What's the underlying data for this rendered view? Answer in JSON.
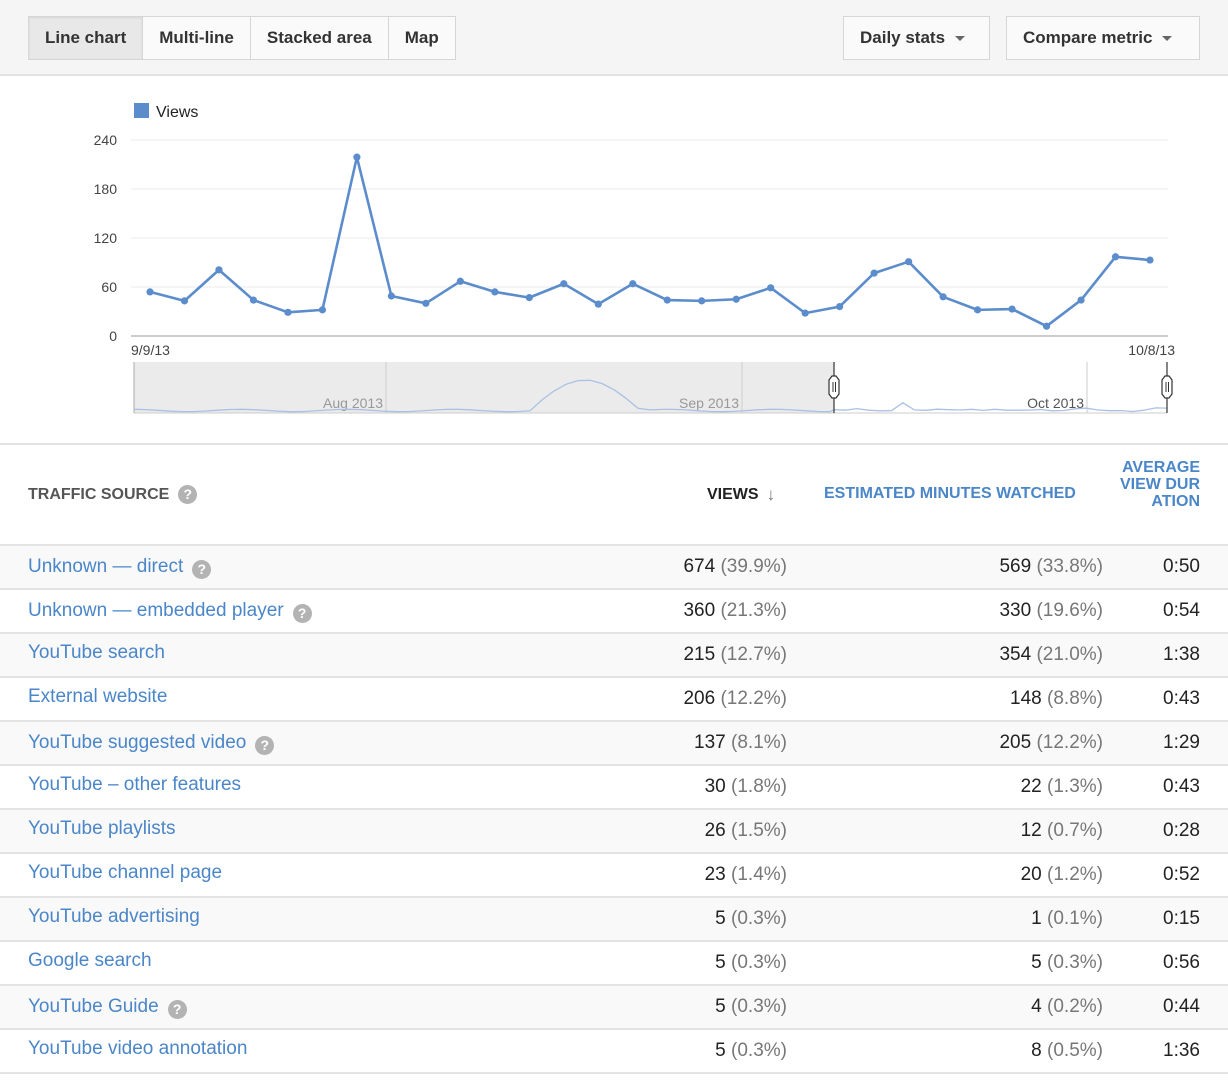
{
  "toolbar": {
    "chart_types": [
      {
        "label": "Line chart",
        "active": true
      },
      {
        "label": "Multi-line",
        "active": false
      },
      {
        "label": "Stacked area",
        "active": false
      },
      {
        "label": "Map",
        "active": false
      }
    ],
    "daily_stats_label": "Daily stats",
    "compare_metric_label": "Compare metric"
  },
  "chart_data": {
    "type": "line",
    "legend": [
      "Views"
    ],
    "legend_placement": "top-left",
    "series": [
      {
        "name": "Views",
        "color": "#5b8ccb",
        "values": [
          54,
          43,
          81,
          44,
          29,
          32,
          219,
          49,
          40,
          67,
          54,
          47,
          64,
          39,
          64,
          44,
          43,
          45,
          59,
          28,
          36,
          77,
          91,
          48,
          32,
          33,
          12,
          44,
          97,
          93
        ]
      }
    ],
    "x_start_label": "9/9/13",
    "x_end_label": "10/8/13",
    "yticks": [
      0,
      60,
      120,
      180,
      240
    ],
    "ylim": [
      0,
      240
    ],
    "grid": true,
    "navigator": {
      "month_labels": [
        "Aug 2013",
        "Sep 2013",
        "Oct 2013"
      ],
      "selected_range": [
        "9/9/13",
        "10/8/13"
      ]
    }
  },
  "table": {
    "headers": {
      "source": "TRAFFIC SOURCE",
      "views": "VIEWS",
      "minutes": "ESTIMATED MINUTES WATCHED",
      "avg": "AVERAGE VIEW DURATION"
    },
    "sort_icon": "arrow-down",
    "help_icon": "?",
    "rows": [
      {
        "source": "Unknown — direct",
        "help": true,
        "views": "674",
        "views_pct": "(39.9%)",
        "minutes": "569",
        "minutes_pct": "(33.8%)",
        "avg": "0:50"
      },
      {
        "source": "Unknown — embedded player",
        "help": true,
        "views": "360",
        "views_pct": "(21.3%)",
        "minutes": "330",
        "minutes_pct": "(19.6%)",
        "avg": "0:54"
      },
      {
        "source": "YouTube search",
        "help": false,
        "views": "215",
        "views_pct": "(12.7%)",
        "minutes": "354",
        "minutes_pct": "(21.0%)",
        "avg": "1:38"
      },
      {
        "source": "External website",
        "help": false,
        "views": "206",
        "views_pct": "(12.2%)",
        "minutes": "148",
        "minutes_pct": "(8.8%)",
        "avg": "0:43"
      },
      {
        "source": "YouTube suggested video",
        "help": true,
        "views": "137",
        "views_pct": "(8.1%)",
        "minutes": "205",
        "minutes_pct": "(12.2%)",
        "avg": "1:29"
      },
      {
        "source": "YouTube – other features",
        "help": false,
        "views": "30",
        "views_pct": "(1.8%)",
        "minutes": "22",
        "minutes_pct": "(1.3%)",
        "avg": "0:43"
      },
      {
        "source": "YouTube playlists",
        "help": false,
        "views": "26",
        "views_pct": "(1.5%)",
        "minutes": "12",
        "minutes_pct": "(0.7%)",
        "avg": "0:28"
      },
      {
        "source": "YouTube channel page",
        "help": false,
        "views": "23",
        "views_pct": "(1.4%)",
        "minutes": "20",
        "minutes_pct": "(1.2%)",
        "avg": "0:52"
      },
      {
        "source": "YouTube advertising",
        "help": false,
        "views": "5",
        "views_pct": "(0.3%)",
        "minutes": "1",
        "minutes_pct": "(0.1%)",
        "avg": "0:15"
      },
      {
        "source": "Google search",
        "help": false,
        "views": "5",
        "views_pct": "(0.3%)",
        "minutes": "5",
        "minutes_pct": "(0.3%)",
        "avg": "0:56"
      },
      {
        "source": "YouTube Guide",
        "help": true,
        "views": "5",
        "views_pct": "(0.3%)",
        "minutes": "4",
        "minutes_pct": "(0.2%)",
        "avg": "0:44"
      },
      {
        "source": "YouTube video annotation",
        "help": false,
        "views": "5",
        "views_pct": "(0.3%)",
        "minutes": "8",
        "minutes_pct": "(0.5%)",
        "avg": "1:36"
      }
    ]
  }
}
